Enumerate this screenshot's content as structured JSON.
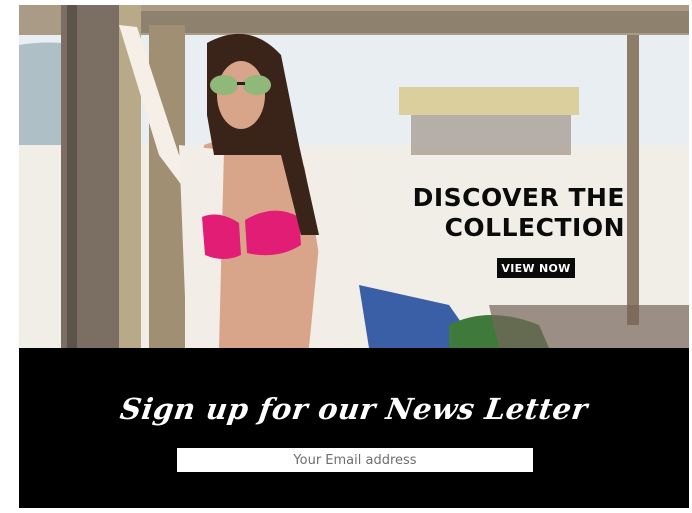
{
  "hero": {
    "title": "DISCOVER THE\nCOLLECTION",
    "cta_label": "VIEW NOW"
  },
  "newsletter": {
    "heading": "Sign up for our News Letter",
    "email_placeholder": "Your Email address"
  },
  "colors": {
    "accent_pink": "#e21d76",
    "footer_background": "#000000",
    "text_dark": "#0b0b0b"
  }
}
